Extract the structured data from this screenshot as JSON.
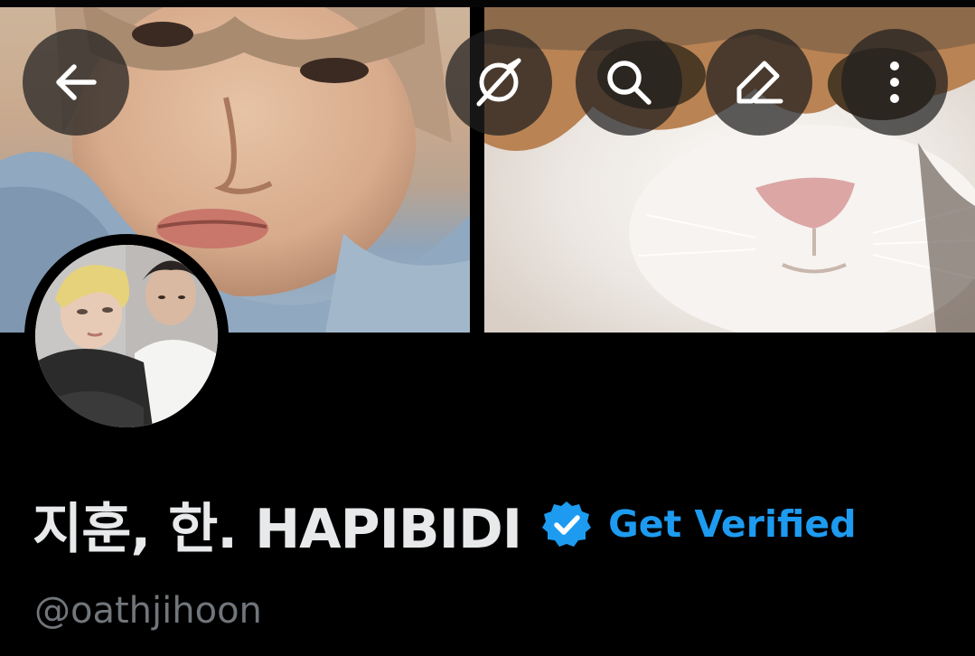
{
  "header": {
    "buttons": [
      {
        "name": "back",
        "icon": "back-arrow-icon"
      },
      {
        "name": "grok",
        "icon": "grok-icon"
      },
      {
        "name": "search",
        "icon": "search-icon"
      },
      {
        "name": "edit",
        "icon": "edit-pencil-icon"
      },
      {
        "name": "more",
        "icon": "more-vertical-icon"
      }
    ]
  },
  "banner": {
    "left_image": "person-photo",
    "right_image": "cat-photo"
  },
  "profile": {
    "display_name": "지훈, 한. HAPIBIDI",
    "verified_icon": "verified-badge-icon",
    "get_verified_label": "Get Verified",
    "handle": "@oathjihoon"
  },
  "colors": {
    "background": "#000000",
    "name": "#e7e9ea",
    "accent": "#1d9bf0",
    "handle": "#71767b",
    "button_overlay": "rgba(30,30,30,0.72)"
  }
}
